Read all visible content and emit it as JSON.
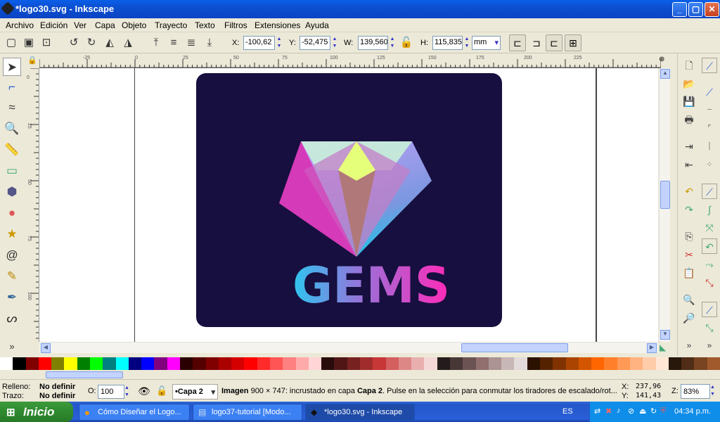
{
  "window": {
    "title": "*logo30.svg - Inkscape",
    "minimize": "_",
    "maximize": "▢",
    "close": "✕"
  },
  "menu": [
    "Archivo",
    "Edición",
    "Ver",
    "Capa",
    "Objeto",
    "Trayecto",
    "Texto",
    "Filtros",
    "Extensiones",
    "Ayuda"
  ],
  "toolbar": {
    "x_label": "X:",
    "x_value": "-100,62",
    "y_label": "Y:",
    "y_value": "-52,475",
    "w_label": "W:",
    "w_value": "139,560",
    "h_label": "H:",
    "h_value": "115,835",
    "unit": "mm"
  },
  "ruler": {
    "h_ticks": [
      "-25",
      "0",
      "25",
      "50",
      "75",
      "100",
      "125",
      "150",
      "175",
      "200",
      "225"
    ],
    "v_ticks": [
      "0",
      "25",
      "50",
      "75",
      "100",
      "125",
      "150"
    ]
  },
  "logo": {
    "text": "GEMS",
    "bg": "#170f3f"
  },
  "palette": [
    "#ffffff",
    "#000000",
    "#800000",
    "#ff0000",
    "#808000",
    "#ffff00",
    "#008000",
    "#00ff00",
    "#008080",
    "#00ffff",
    "#000080",
    "#0000ff",
    "#800080",
    "#ff00ff",
    "#2b0000",
    "#550000",
    "#800000",
    "#aa0000",
    "#d40000",
    "#ff0000",
    "#ff2a2a",
    "#ff5555",
    "#ff8080",
    "#ffaaaa",
    "#ffd5d5",
    "#280b0b",
    "#501616",
    "#782121",
    "#a02c2c",
    "#c83737",
    "#d35f5f",
    "#de8787",
    "#e9afaf",
    "#f4d7d7",
    "#241c1c",
    "#483737",
    "#6c5353",
    "#916f6f",
    "#ac9393",
    "#c8b7b7",
    "#e3dbdb",
    "#2b1100",
    "#552200",
    "#803300",
    "#aa4400",
    "#d45500",
    "#ff6600",
    "#ff7f2a",
    "#ff9955",
    "#ffb380",
    "#ffccaa",
    "#ffe6d5",
    "#28170b",
    "#502d16",
    "#784421",
    "#a05a2c"
  ],
  "status": {
    "fill_label": "Relleno:",
    "fill_value": "No definir",
    "stroke_label": "Trazo:",
    "stroke_value": "No definir",
    "opacity_label": "O:",
    "opacity_value": "100",
    "layer": "•Capa 2",
    "message_bold": "Imagen",
    "message_rest": " 900 × 747: incrustado en capa ",
    "message_layer": "Capa 2",
    "message_tail": ". Pulse en la selección para conmutar los tiradores de escalado/rot...",
    "cx_label": "X:",
    "cx_value": "237,96",
    "cy_label": "Y:",
    "cy_value": "141,43",
    "zoom_label": "Z:",
    "zoom_value": "83%"
  },
  "taskbar": {
    "start": "Inicio",
    "tasks": [
      "Cómo Diseñar el Logo...",
      "logo37-tutorial [Modo...",
      "*logo30.svg - Inkscape"
    ],
    "lang": "ES",
    "clock": "04:34 p.m."
  }
}
